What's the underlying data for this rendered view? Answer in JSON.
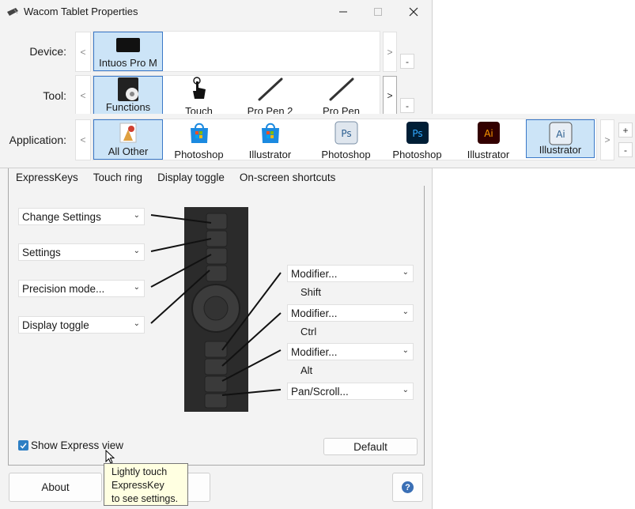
{
  "window": {
    "title": "Wacom Tablet Properties"
  },
  "device": {
    "label": "Device:",
    "items": [
      "Intuos Pro M"
    ],
    "prev": "<",
    "next": ">",
    "remove": "-"
  },
  "tool": {
    "label": "Tool:",
    "items": [
      "Functions",
      "Touch",
      "Pro Pen 2",
      "Pro Pen"
    ],
    "prev": "<",
    "next": ">",
    "remove": "-"
  },
  "application": {
    "label": "Application:",
    "items": [
      "All Other",
      "Photoshop",
      "Illustrator",
      "Photoshop",
      "Photoshop",
      "Illustrator",
      "Illustrator"
    ],
    "prev": "<",
    "next": ">",
    "add": "+",
    "remove": "-"
  },
  "tabs": [
    "ExpressKeys",
    "Touch ring",
    "Display toggle",
    "On-screen shortcuts"
  ],
  "left_keys": [
    "Change Settings",
    "Settings",
    "Precision mode...",
    "Display toggle"
  ],
  "right_keys": [
    {
      "value": "Modifier...",
      "sub": "Shift"
    },
    {
      "value": "Modifier...",
      "sub": "Ctrl"
    },
    {
      "value": "Modifier...",
      "sub": "Alt"
    },
    {
      "value": "Pan/Scroll...",
      "sub": ""
    }
  ],
  "show_express_view": {
    "label": "Show Express view",
    "checked": true
  },
  "buttons": {
    "default": "Default",
    "about": "About",
    "help": "?"
  },
  "tooltip": {
    "line1": "Lightly touch",
    "line2": "ExpressKey",
    "line3": "to see settings."
  },
  "colors": {
    "accent": "#2d7fc4",
    "selected": "#cce4f7"
  }
}
